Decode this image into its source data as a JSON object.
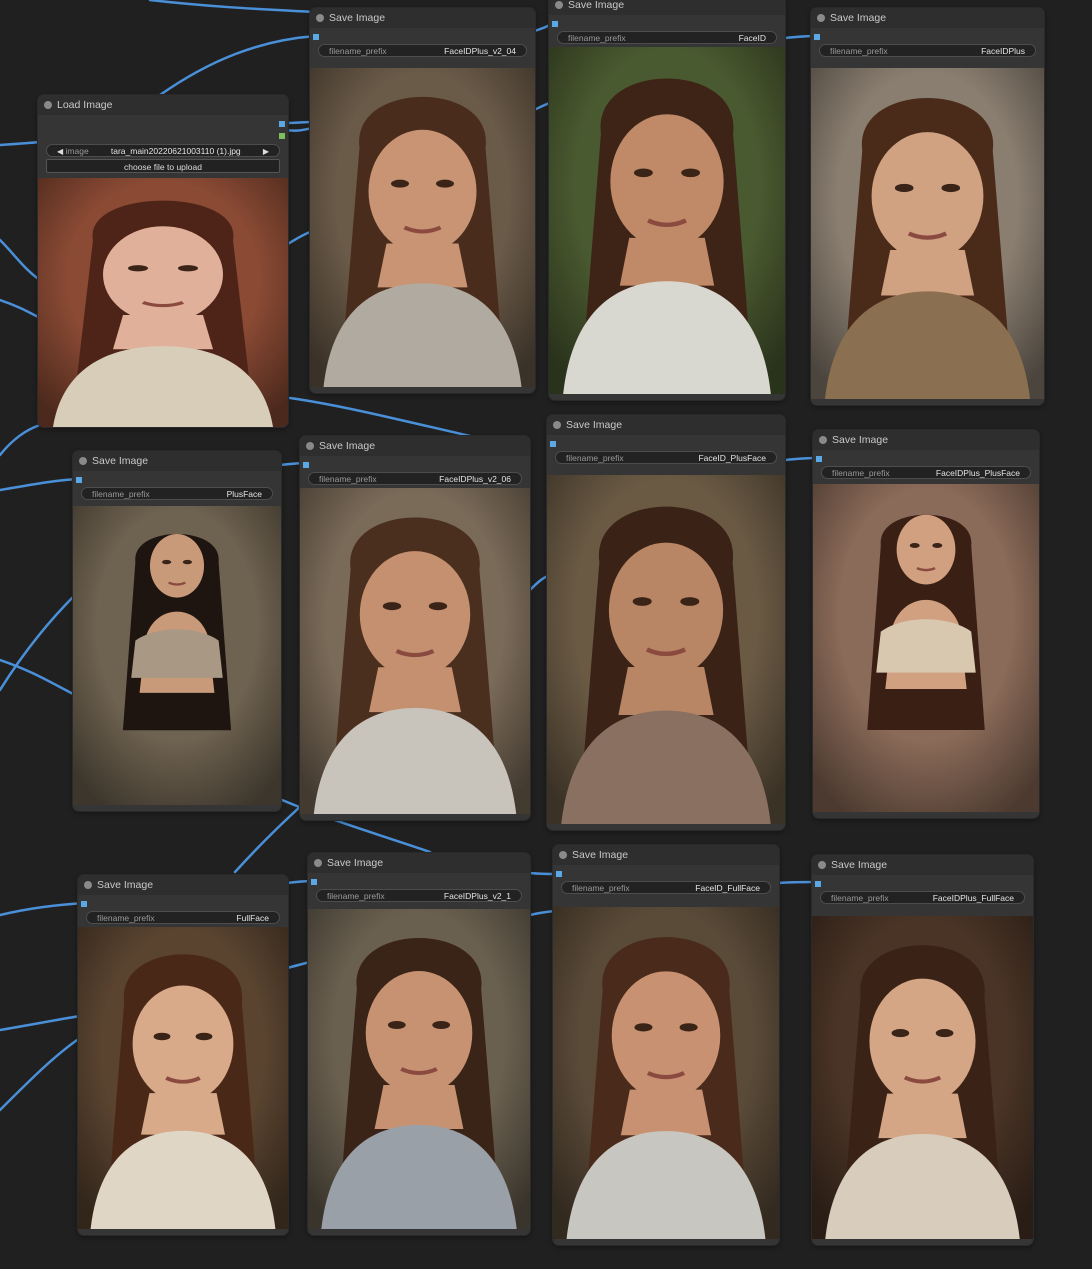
{
  "load_node": {
    "title": "Load Image",
    "image_label": "image",
    "image_value": "tara_main20220621003110 (1).jpg",
    "upload_label": "choose file to upload"
  },
  "save_nodes": [
    {
      "title": "Save Image",
      "label": "filename_prefix",
      "prefix": "FaceIDPlus_v2_04",
      "hair": "#4a2c1c",
      "skin": "#c89474",
      "bg": "#6a5a48",
      "cloth": "#b0aaa0"
    },
    {
      "title": "Save Image",
      "label": "filename_prefix",
      "prefix": "FaceID",
      "hair": "#3e2416",
      "skin": "#c08a68",
      "bg": "#4a5a30",
      "cloth": "#d8d8d0"
    },
    {
      "title": "Save Image",
      "label": "filename_prefix",
      "prefix": "FaceIDPlus",
      "hair": "#4a2a18",
      "skin": "#d0a282",
      "bg": "#8a7e70",
      "cloth": "#8a7050"
    },
    {
      "title": "Save Image",
      "label": "filename_prefix",
      "prefix": "PlusFace",
      "hair": "#1e1410",
      "skin": "#c89a7a",
      "bg": "#6e6250",
      "cloth": "#a89884"
    },
    {
      "title": "Save Image",
      "label": "filename_prefix",
      "prefix": "FaceIDPlus_v2_06",
      "hair": "#4a2e1e",
      "skin": "#c49070",
      "bg": "#7a6a58",
      "cloth": "#c8c4bc"
    },
    {
      "title": "Save Image",
      "label": "filename_prefix",
      "prefix": "FaceID_PlusFace",
      "hair": "#3a2216",
      "skin": "#b88664",
      "bg": "#6a5a44",
      "cloth": "#8a7060"
    },
    {
      "title": "Save Image",
      "label": "filename_prefix",
      "prefix": "FaceIDPlus_PlusFace",
      "hair": "#3a2014",
      "skin": "#d0a080",
      "bg": "#8a6a58",
      "cloth": "#d8c8b0"
    },
    {
      "title": "Save Image",
      "label": "filename_prefix",
      "prefix": "FullFace",
      "hair": "#4a2818",
      "skin": "#d8aa8a",
      "bg": "#5a4430",
      "cloth": "#e0d6c6"
    },
    {
      "title": "Save Image",
      "label": "filename_prefix",
      "prefix": "FaceIDPlus_v2_1",
      "hair": "#3a2418",
      "skin": "#c69272",
      "bg": "#6a6050",
      "cloth": "#9aa0a8"
    },
    {
      "title": "Save Image",
      "label": "filename_prefix",
      "prefix": "FaceID_FullFace",
      "hair": "#4a2a1a",
      "skin": "#c89272",
      "bg": "#5a4a38",
      "cloth": "#c8c6c0"
    },
    {
      "title": "Save Image",
      "label": "filename_prefix",
      "prefix": "FaceIDPlus_FullFace",
      "hair": "#3a2216",
      "skin": "#d4a686",
      "bg": "#4a3426",
      "cloth": "#d8ccbc"
    }
  ],
  "source_portrait": {
    "hair": "#4e2418",
    "skin": "#e0b09a",
    "bg": "#8a4a34",
    "cloth": "#d8cdb8"
  },
  "colors": {
    "canvas": "#202020",
    "node": "#353535",
    "link": "#4a90d9",
    "slot_image": "#5aa9e6",
    "slot_mask": "#7fbf5a"
  }
}
